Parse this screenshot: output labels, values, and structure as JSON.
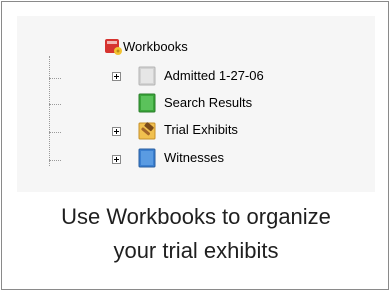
{
  "tree": {
    "root": {
      "label": "Workbooks",
      "icon": "workbooks-icon"
    },
    "items": [
      {
        "label": "Admitted 1-27-06",
        "icon": "gray-book-icon",
        "expandable": true,
        "color": "#cfcfcf"
      },
      {
        "label": "Search Results",
        "icon": "green-book-icon",
        "expandable": false,
        "color": "#3aa53a"
      },
      {
        "label": "Trial Exhibits",
        "icon": "gavel-icon",
        "expandable": true,
        "color": "#d98a2b"
      },
      {
        "label": "Witnesses",
        "icon": "blue-book-icon",
        "expandable": true,
        "color": "#3a7fd1"
      }
    ]
  },
  "caption": {
    "line1": "Use Workbooks to organize",
    "line2": "your trial exhibits"
  }
}
